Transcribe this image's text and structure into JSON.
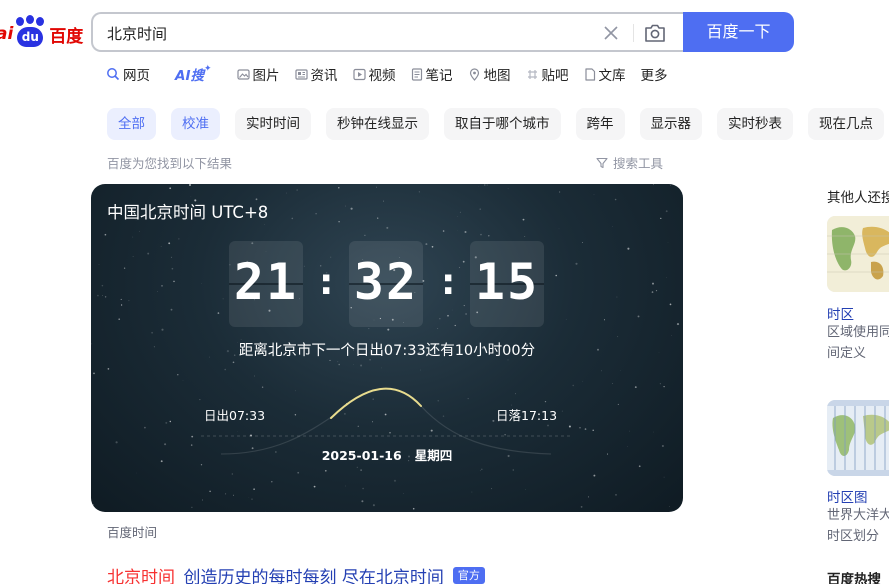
{
  "logo": {
    "prefix": "ai",
    "badge": "du",
    "name": "百度"
  },
  "search": {
    "query": "北京时间",
    "button_label": "百度一下"
  },
  "tabs": [
    {
      "label": "网页",
      "icon": "search-icon"
    },
    {
      "label": "AI搜",
      "icon": "ai-icon"
    },
    {
      "label": "图片",
      "icon": "image-icon"
    },
    {
      "label": "资讯",
      "icon": "news-icon"
    },
    {
      "label": "视频",
      "icon": "video-icon"
    },
    {
      "label": "笔记",
      "icon": "note-icon"
    },
    {
      "label": "地图",
      "icon": "map-icon"
    },
    {
      "label": "贴吧",
      "icon": "tieba-icon"
    },
    {
      "label": "文库",
      "icon": "doc-icon"
    },
    {
      "label": "更多",
      "icon": ""
    }
  ],
  "chips": [
    "全部",
    "校准",
    "实时时间",
    "秒钟在线显示",
    "取自于哪个城市",
    "跨年",
    "显示器",
    "实时秒表",
    "现在几点"
  ],
  "results_meta": {
    "found_text": "百度为您找到以下结果",
    "tools_label": "搜索工具"
  },
  "clock": {
    "title": "中国北京时间 UTC+8",
    "hours": "21",
    "minutes": "32",
    "seconds": "15",
    "sunrise_note": "距离北京市下一个日出07:33还有10小时00分",
    "sunrise_label": "日出07:33",
    "sunset_label": "日落17:13",
    "date": "2025-01-16",
    "weekday": "星期四",
    "source": "百度时间"
  },
  "first_result": {
    "highlight": "北京时间",
    "rest": "_创造历史的每时每刻 尽在北京时间",
    "badge": "官方"
  },
  "right_panel": {
    "heading": "其他人还搜",
    "item1": {
      "title": "时区",
      "desc_line1": "区域使用同",
      "desc_line2": "间定义"
    },
    "item2": {
      "title": "时区图",
      "desc_line1": "世界大洋大",
      "desc_line2": "时区划分"
    },
    "hot_heading": "百度热搜"
  },
  "colors": {
    "brand_blue": "#4e6ef2",
    "brand_red": "#e10602",
    "link": "#2440b3",
    "highlight": "#f73131"
  }
}
